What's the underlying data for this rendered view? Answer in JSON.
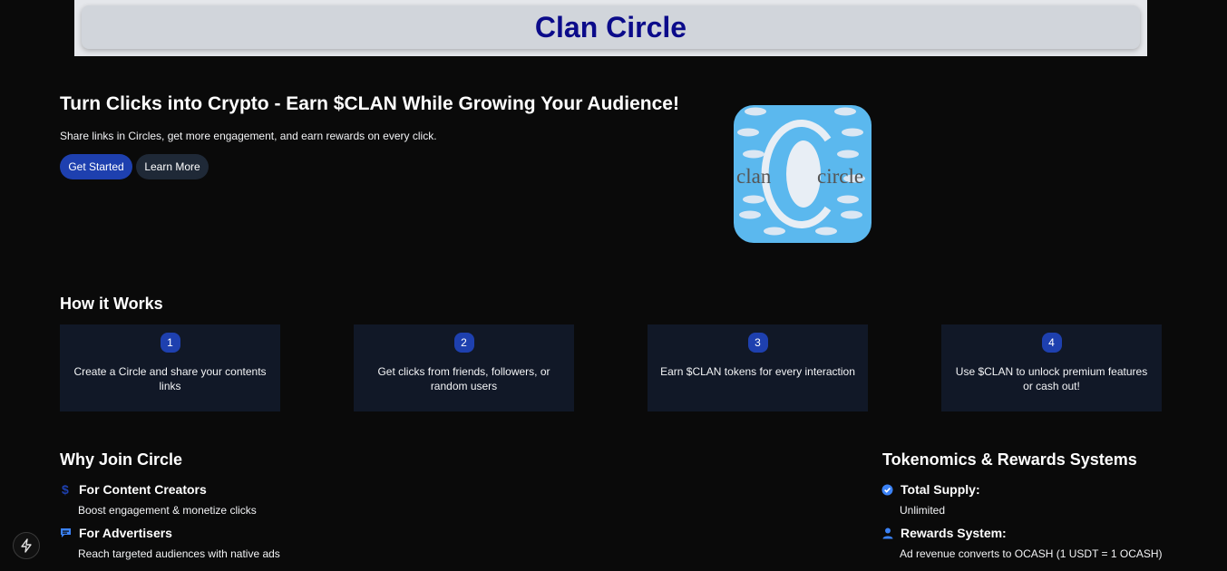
{
  "header": {
    "title": "Clan Circle"
  },
  "hero": {
    "title": "Turn Clicks into Crypto - Earn $CLAN While Growing Your Audience!",
    "subtitle": "Share links in Circles, get more engagement, and earn rewards on every click.",
    "primary_button": "Get Started",
    "secondary_button": "Learn More",
    "logo": {
      "left_word": "clan",
      "right_word": "circle"
    }
  },
  "how_it_works": {
    "title": "How it Works",
    "steps": [
      {
        "number": "1",
        "text": "Create a Circle and share your contents links"
      },
      {
        "number": "2",
        "text": "Get clicks from friends, followers, or random users"
      },
      {
        "number": "3",
        "text": "Earn $CLAN tokens for every interaction"
      },
      {
        "number": "4",
        "text": "Use $CLAN to unlock premium features or cash out!"
      }
    ]
  },
  "why_join": {
    "title": "Why Join Circle",
    "items": [
      {
        "icon": "dollar-icon",
        "title": "For Content Creators",
        "desc": "Boost engagement & monetize clicks"
      },
      {
        "icon": "chat-icon",
        "title": "For Advertisers",
        "desc": "Reach targeted audiences with native ads"
      }
    ]
  },
  "tokenomics": {
    "title": "Tokenomics & Rewards Systems",
    "items": [
      {
        "icon": "check-circle-icon",
        "title": "Total Supply:",
        "desc": "Unlimited"
      },
      {
        "icon": "user-icon",
        "title": "Rewards System:",
        "desc": "Ad revenue converts to OCASH (1 USDT = 1 OCASH)"
      }
    ]
  },
  "colors": {
    "accent": "#1e40af",
    "header_title": "#0b0b8a",
    "card_bg": "#111827",
    "logo_bg": "#5bb8ee"
  }
}
